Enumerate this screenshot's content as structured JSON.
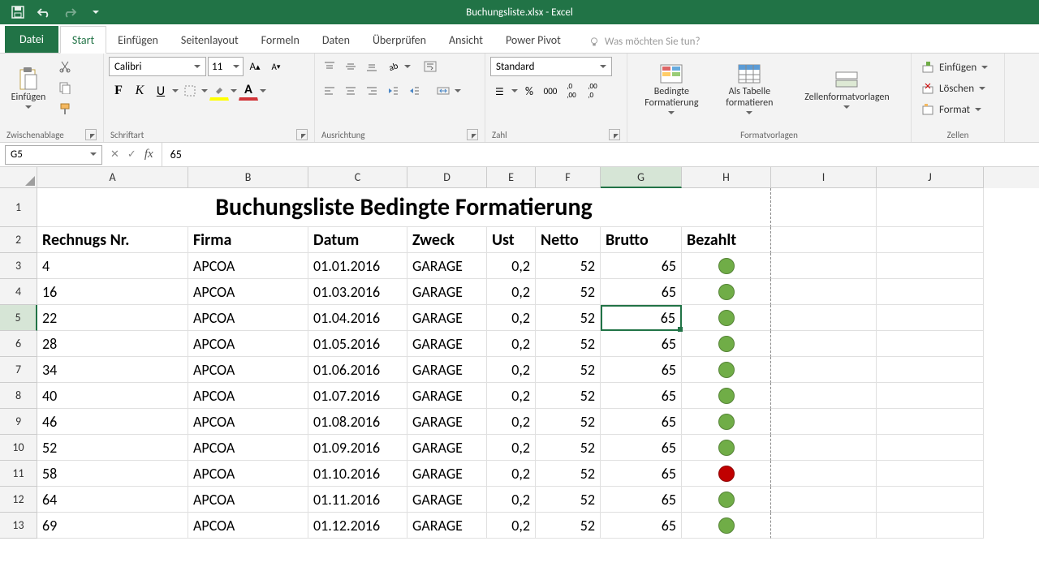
{
  "app": {
    "title": "Buchungsliste.xlsx - Excel"
  },
  "tabs": {
    "file": "Datei",
    "items": [
      "Start",
      "Einfügen",
      "Seitenlayout",
      "Formeln",
      "Daten",
      "Überprüfen",
      "Ansicht",
      "Power Pivot"
    ],
    "active": 0,
    "tellme_placeholder": "Was möchten Sie tun?"
  },
  "ribbon": {
    "clipboard": {
      "paste": "Einfügen",
      "group": "Zwischenablage"
    },
    "font": {
      "name": "Calibri",
      "size": "11",
      "group": "Schriftart"
    },
    "alignment": {
      "group": "Ausrichtung"
    },
    "number": {
      "format": "Standard",
      "group": "Zahl"
    },
    "styles": {
      "cond": "Bedingte\nFormatierung",
      "table": "Als Tabelle\nformatieren",
      "cell": "Zellenformatvorlagen",
      "group": "Formatvorlagen"
    },
    "cells": {
      "insert": "Einfügen",
      "delete": "Löschen",
      "format": "Format",
      "group": "Zellen"
    }
  },
  "formula_bar": {
    "name_box": "G5",
    "value": "65"
  },
  "columns": [
    "A",
    "B",
    "C",
    "D",
    "E",
    "F",
    "G",
    "H",
    "I",
    "J"
  ],
  "selected_col": "G",
  "selected_row": 5,
  "chart_data": {
    "type": "table",
    "title": "Buchungsliste Bedingte Formatierung",
    "columns": [
      "Rechnugs Nr.",
      "Firma",
      "Datum",
      "Zweck",
      "Ust",
      "Netto",
      "Brutto",
      "Bezahlt"
    ],
    "rows": [
      {
        "nr": "4",
        "firma": "APCOA",
        "datum": "01.01.2016",
        "zweck": "GARAGE",
        "ust": "0,2",
        "netto": "52",
        "brutto": "65",
        "bezahlt": "green"
      },
      {
        "nr": "16",
        "firma": "APCOA",
        "datum": "01.03.2016",
        "zweck": "GARAGE",
        "ust": "0,2",
        "netto": "52",
        "brutto": "65",
        "bezahlt": "green"
      },
      {
        "nr": "22",
        "firma": "APCOA",
        "datum": "01.04.2016",
        "zweck": "GARAGE",
        "ust": "0,2",
        "netto": "52",
        "brutto": "65",
        "bezahlt": "green"
      },
      {
        "nr": "28",
        "firma": "APCOA",
        "datum": "01.05.2016",
        "zweck": "GARAGE",
        "ust": "0,2",
        "netto": "52",
        "brutto": "65",
        "bezahlt": "green"
      },
      {
        "nr": "34",
        "firma": "APCOA",
        "datum": "01.06.2016",
        "zweck": "GARAGE",
        "ust": "0,2",
        "netto": "52",
        "brutto": "65",
        "bezahlt": "green"
      },
      {
        "nr": "40",
        "firma": "APCOA",
        "datum": "01.07.2016",
        "zweck": "GARAGE",
        "ust": "0,2",
        "netto": "52",
        "brutto": "65",
        "bezahlt": "green"
      },
      {
        "nr": "46",
        "firma": "APCOA",
        "datum": "01.08.2016",
        "zweck": "GARAGE",
        "ust": "0,2",
        "netto": "52",
        "brutto": "65",
        "bezahlt": "green"
      },
      {
        "nr": "52",
        "firma": "APCOA",
        "datum": "01.09.2016",
        "zweck": "GARAGE",
        "ust": "0,2",
        "netto": "52",
        "brutto": "65",
        "bezahlt": "green"
      },
      {
        "nr": "58",
        "firma": "APCOA",
        "datum": "01.10.2016",
        "zweck": "GARAGE",
        "ust": "0,2",
        "netto": "52",
        "brutto": "65",
        "bezahlt": "red"
      },
      {
        "nr": "64",
        "firma": "APCOA",
        "datum": "01.11.2016",
        "zweck": "GARAGE",
        "ust": "0,2",
        "netto": "52",
        "brutto": "65",
        "bezahlt": "green"
      },
      {
        "nr": "69",
        "firma": "APCOA",
        "datum": "01.12.2016",
        "zweck": "GARAGE",
        "ust": "0,2",
        "netto": "52",
        "brutto": "65",
        "bezahlt": "green"
      }
    ]
  }
}
